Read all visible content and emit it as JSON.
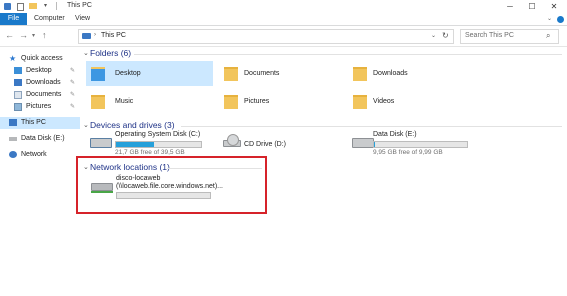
{
  "window": {
    "title": "This PC",
    "controls": {
      "minimize": "─",
      "maximize": "☐",
      "close": "✕"
    }
  },
  "ribbon": {
    "tabs": [
      "File",
      "Computer",
      "View"
    ]
  },
  "nav": {
    "back": "←",
    "forward": "→",
    "up": "↑",
    "breadcrumb": "This PC",
    "search_placeholder": "Search This PC"
  },
  "sidebar": {
    "quick_access": "Quick access",
    "quick_items": [
      "Desktop",
      "Downloads",
      "Documents",
      "Pictures"
    ],
    "this_pc": "This PC",
    "data_disk": "Data Disk (E:)",
    "network": "Network"
  },
  "folders": {
    "heading": "Folders (6)",
    "items": [
      "Desktop",
      "Documents",
      "Downloads",
      "Music",
      "Pictures",
      "Videos"
    ]
  },
  "devices": {
    "heading": "Devices and drives (3)",
    "os_disk": {
      "name": "Operating System Disk (C:)",
      "free": "21,7 GB free of 39,5 GB",
      "used_fraction": 0.45
    },
    "cd_drive": {
      "name": "CD Drive (D:)"
    },
    "data_disk": {
      "name": "Data Disk (E:)",
      "free": "9,95 GB free of 9,99 GB",
      "used_fraction": 0.004
    }
  },
  "network_locations": {
    "heading": "Network locations (1)",
    "item": {
      "name": "disco-locaweb",
      "path": "(\\\\locaweb.file.core.windows.net)...",
      "used_fraction": 0.0
    }
  },
  "colors": {
    "highlight": "#d6232a",
    "accent": "#1979ca",
    "selection": "#cce8ff",
    "disk_fill": "#26a0da"
  }
}
